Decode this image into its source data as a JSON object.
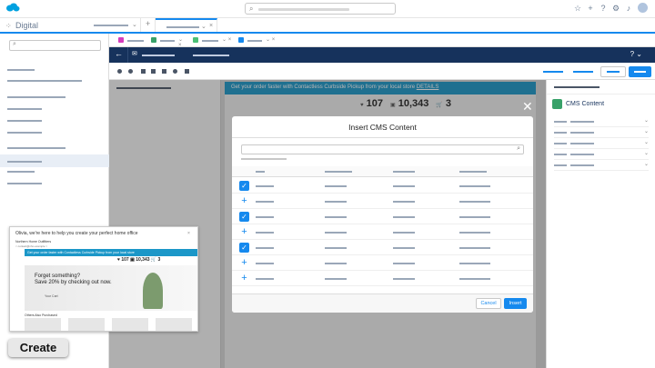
{
  "app": {
    "name": "Digital"
  },
  "modal": {
    "title": "Insert CMS Content",
    "close_icon": "close-icon",
    "cancel_label": "Cancel",
    "insert_label": "Insert",
    "rows": [
      {
        "selected": true
      },
      {
        "selected": false
      },
      {
        "selected": true
      },
      {
        "selected": false
      },
      {
        "selected": true
      },
      {
        "selected": false
      },
      {
        "selected": false
      }
    ]
  },
  "right_panel": {
    "cms_label": "CMS Content"
  },
  "preview": {
    "promo": "Get your order faster with Contactless Curbside Pickup from your local store",
    "promo_link": "DETAILS",
    "stat1": "107",
    "stat2": "10,343",
    "stat3": "3"
  },
  "thumbnail": {
    "greeting": "Olivia, we're here to help you create your perfect home office",
    "from": "Northern Home Outfitters",
    "from_sub": "< contact@nho.example >",
    "banner": "Get your order faster with Contactless Curbside Pickup from your local store",
    "stat1": "107",
    "stat2": "10,343",
    "stat3": "3",
    "headline_1": "Forget something?",
    "headline_2": "Save 20% by checking out now.",
    "shop_link": "Your Cart",
    "also": "Others Also Purchased"
  },
  "create_label": "Create",
  "colors": {
    "brand_blue": "#1589ee",
    "navy": "#16325c",
    "promo": "#1b97c8",
    "cms_green": "#38a169"
  }
}
